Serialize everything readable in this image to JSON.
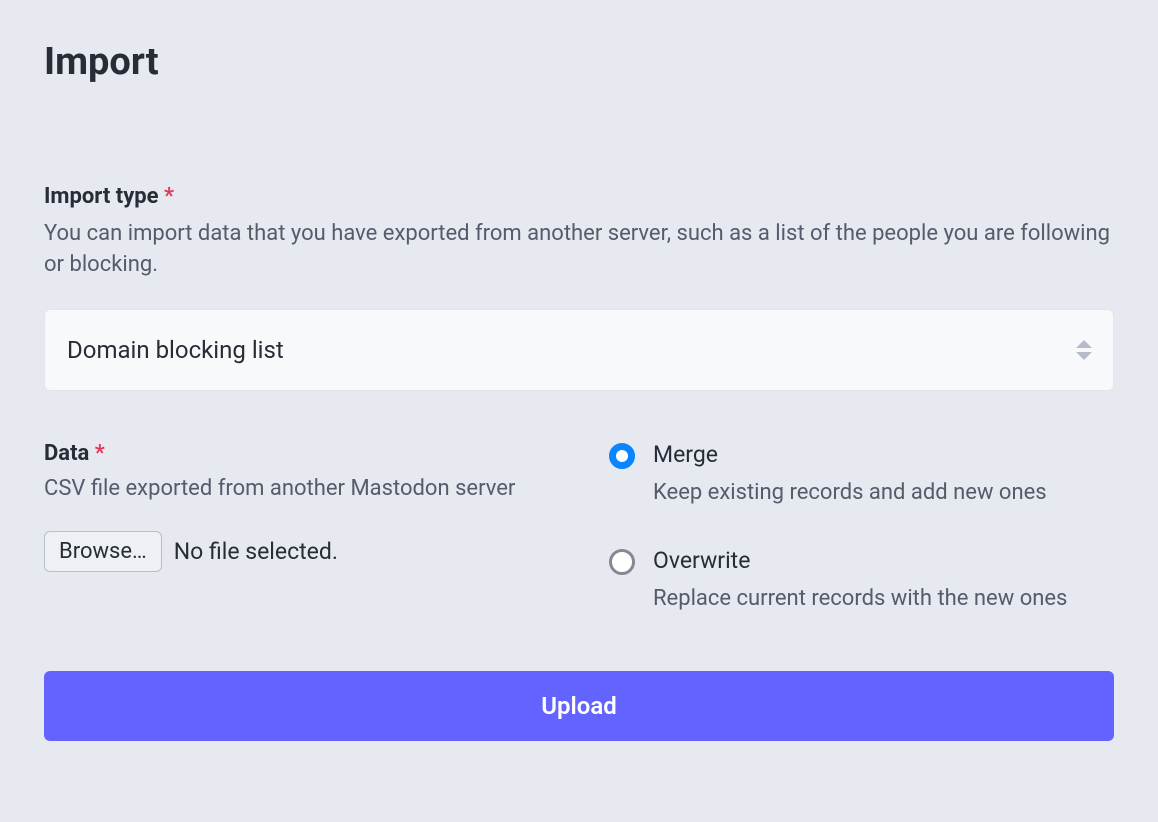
{
  "page": {
    "title": "Import"
  },
  "import_type": {
    "label": "Import type",
    "required_marker": "*",
    "hint": "You can import data that you have exported from another server, such as a list of the people you are following or blocking.",
    "selected": "Domain blocking list"
  },
  "data_section": {
    "label": "Data",
    "required_marker": "*",
    "hint": "CSV file exported from another Mastodon server",
    "browse_label": "Browse…",
    "file_status": "No file selected."
  },
  "mode": {
    "options": [
      {
        "title": "Merge",
        "description": "Keep existing records and add new ones",
        "checked": true
      },
      {
        "title": "Overwrite",
        "description": "Replace current records with the new ones",
        "checked": false
      }
    ]
  },
  "actions": {
    "upload_label": "Upload"
  }
}
